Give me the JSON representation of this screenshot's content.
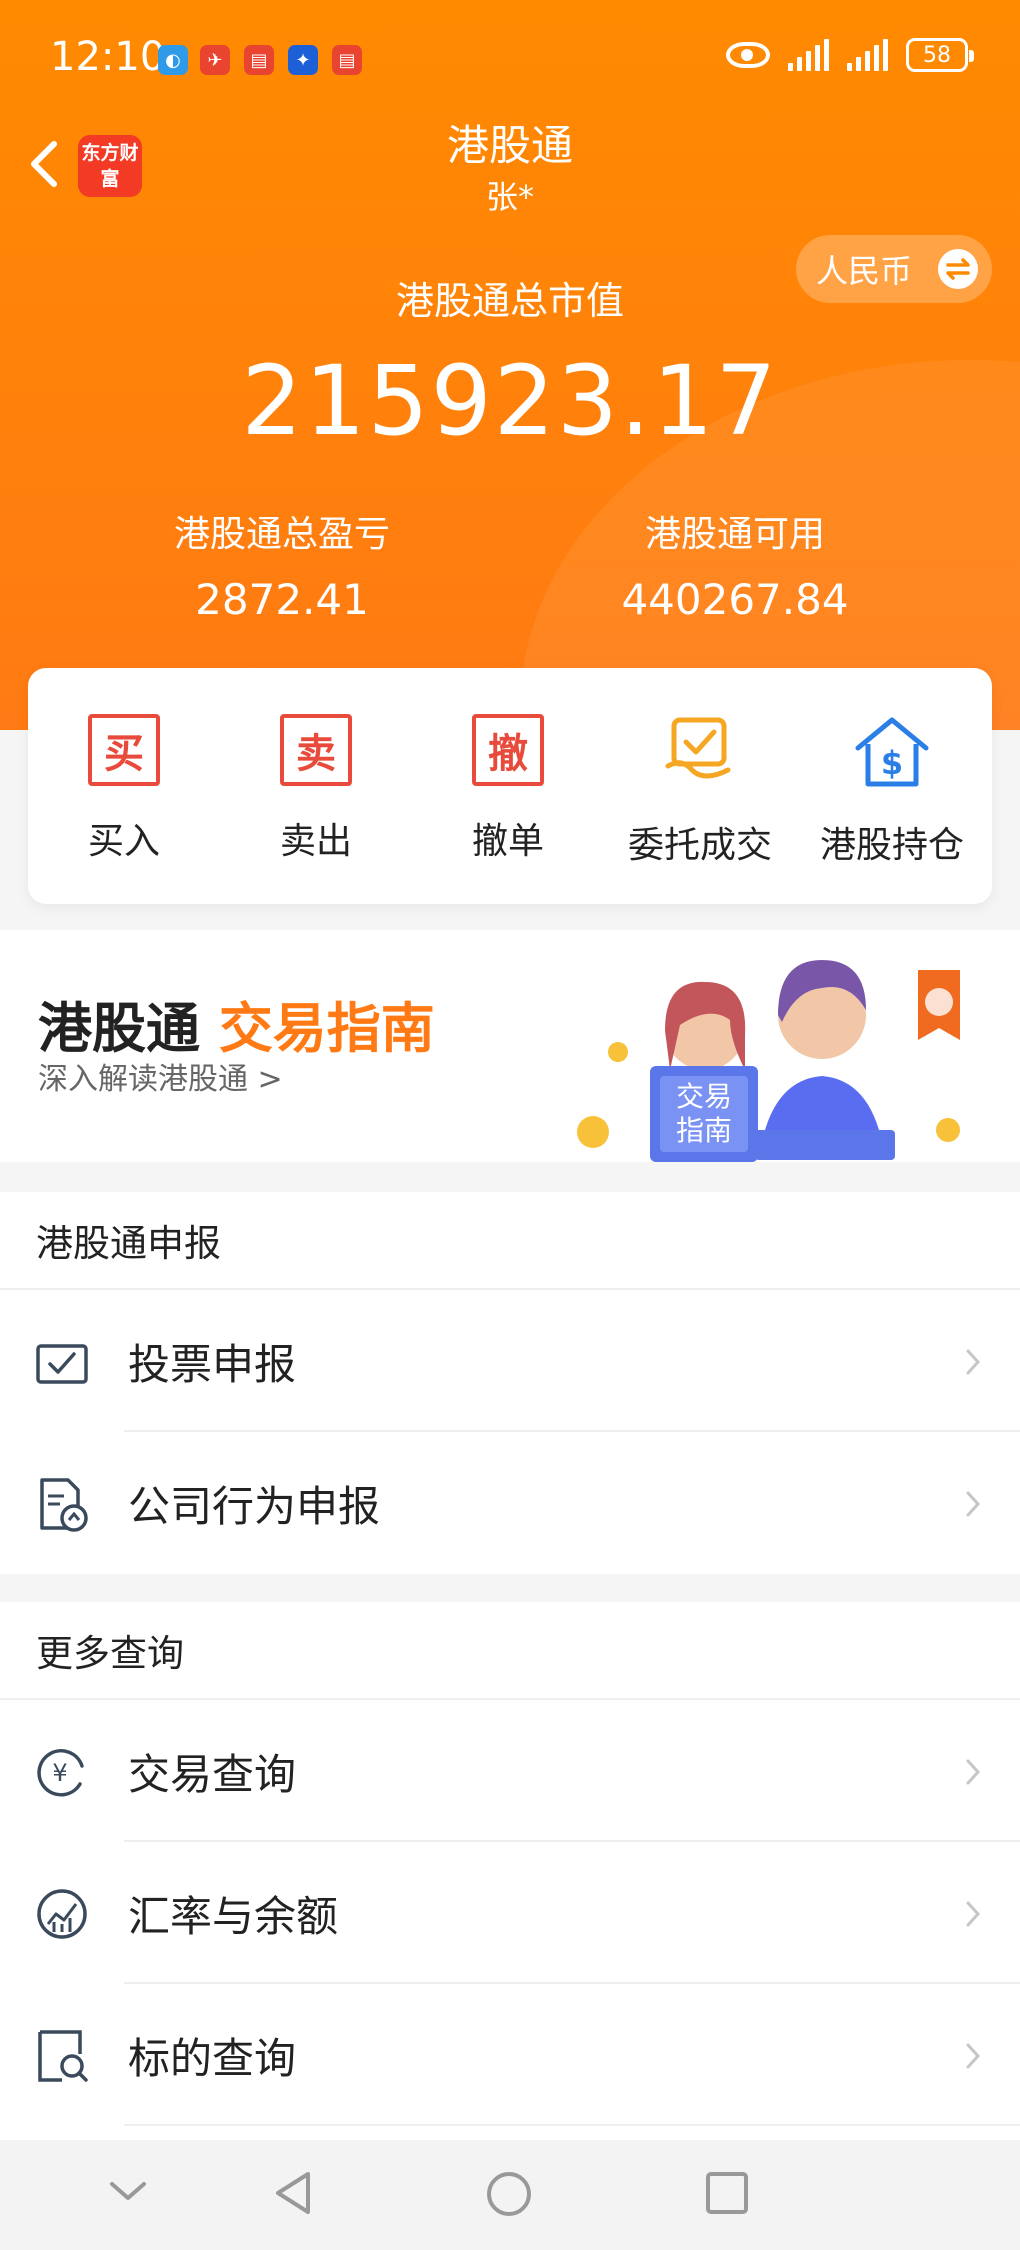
{
  "status_bar": {
    "time": "12:10",
    "battery": "58"
  },
  "header": {
    "title": "港股通",
    "subtitle": "张*",
    "logo_text": "东方财富",
    "currency_label": "人民币",
    "total_label": "港股通总市值",
    "total_value": "215923.17",
    "profit_label": "港股通总盈亏",
    "profit_value": "2872.41",
    "available_label": "港股通可用",
    "available_value": "440267.84"
  },
  "actions": [
    {
      "label": "买入",
      "glyph": "买"
    },
    {
      "label": "卖出",
      "glyph": "卖"
    },
    {
      "label": "撤单",
      "glyph": "撤"
    },
    {
      "label": "委托成交"
    },
    {
      "label": "港股持仓"
    }
  ],
  "banner": {
    "title_main": "港股通",
    "title_highlight": "交易指南",
    "subtitle": "深入解读港股通 >",
    "book_text": "交易指南"
  },
  "sections": [
    {
      "title": "港股通申报",
      "items": [
        {
          "label": "投票申报",
          "icon": "vote-icon"
        },
        {
          "label": "公司行为申报",
          "icon": "document-upload-icon"
        }
      ]
    },
    {
      "title": "更多查询",
      "items": [
        {
          "label": "交易查询",
          "icon": "yuan-refresh-icon"
        },
        {
          "label": "汇率与余额",
          "icon": "chart-gauge-icon"
        },
        {
          "label": "标的查询",
          "icon": "search-doc-icon"
        }
      ]
    }
  ],
  "colors": {
    "brand_orange": "#ff8a00",
    "action_red": "#e84b3b",
    "action_yellow": "#f5a623",
    "action_blue": "#2a7ee6"
  }
}
